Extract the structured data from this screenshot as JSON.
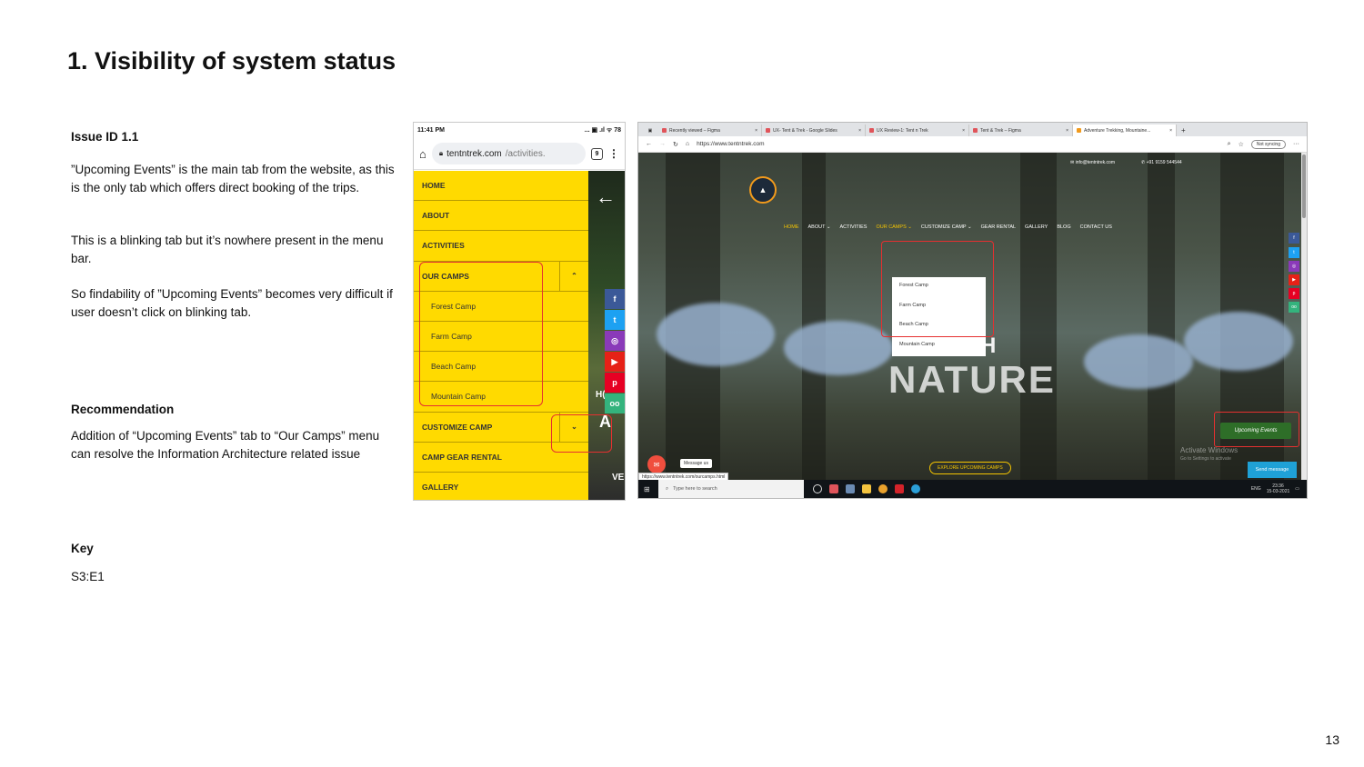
{
  "slide": {
    "title": "1. Visibility of system status",
    "page_number": "13",
    "issue_id": "Issue ID 1.1",
    "para1": "”Upcoming Events” is the main tab from the website, as this is the only tab which offers direct booking of the trips.",
    "para2": "This is a blinking tab but it’s nowhere present in the menu bar.",
    "para3": "So findability of ”Upcoming Events” becomes very difficult if user doesn’t click on blinking tab.",
    "recommendation_heading": "Recommendation",
    "recommendation": "Addition of “Upcoming Events” tab to “Our Camps” menu can resolve the Information Architecture related issue",
    "key_heading": "Key",
    "key_value": "S3:E1"
  },
  "phone": {
    "time": "11:41 PM",
    "status_icons": "... ▣ .ıl ᯤ 78",
    "url_domain": "tentntrek.com",
    "url_path": "/activities.",
    "tab_count": "9",
    "menu": [
      {
        "label": "HOME"
      },
      {
        "label": "ABOUT"
      },
      {
        "label": "ACTIVITIES"
      },
      {
        "label": "OUR CAMPS",
        "chevron": "⌃"
      },
      {
        "label": "Forest Camp",
        "sub": true
      },
      {
        "label": "Farm Camp",
        "sub": true
      },
      {
        "label": "Beach Camp",
        "sub": true
      },
      {
        "label": "Mountain Camp",
        "sub": true
      },
      {
        "label": "CUSTOMIZE CAMP",
        "chevron": "⌄"
      },
      {
        "label": "CAMP GEAR RENTAL"
      },
      {
        "label": "GALLERY"
      }
    ],
    "photo_text_1": "H(",
    "photo_text_2": "A",
    "photo_text_3": "VE",
    "social_icons": [
      {
        "name": "facebook-icon",
        "glyph": "f",
        "color": "#3b5998"
      },
      {
        "name": "twitter-icon",
        "glyph": "t",
        "color": "#1da1f2"
      },
      {
        "name": "instagram-icon",
        "glyph": "◎",
        "color": "#8a3ab9"
      },
      {
        "name": "youtube-icon",
        "glyph": "▶",
        "color": "#e62117"
      },
      {
        "name": "pinterest-icon",
        "glyph": "p",
        "color": "#e60023"
      },
      {
        "name": "tripadvisor-icon",
        "glyph": "oo",
        "color": "#34b37d"
      }
    ]
  },
  "desktop": {
    "tabs": [
      {
        "label": "Recently viewed – Figma"
      },
      {
        "label": "UX- Tent & Trek - Google Slides"
      },
      {
        "label": "UX Review-1: Tent n Trek"
      },
      {
        "label": "Tent & Trek – Figma"
      },
      {
        "label": "Adventure Trekking, Mountaine...",
        "active": true
      }
    ],
    "new_tab": "+",
    "url": "https://www.tentntrek.com",
    "not_syncing": "Not syncing",
    "email": "✉ info@tentntrek.com",
    "phone": "✆ +91 9159 544544",
    "nav": [
      {
        "label": "HOME",
        "active": true
      },
      {
        "label": "ABOUT ⌄"
      },
      {
        "label": "ACTIVITIES"
      },
      {
        "label": "OUR CAMPS ⌄",
        "active": true
      },
      {
        "label": "CUSTOMIZE CAMP ⌄"
      },
      {
        "label": "GEAR RENTAL"
      },
      {
        "label": "GALLERY"
      },
      {
        "label": "BLOG"
      },
      {
        "label": "CONTACT US"
      }
    ],
    "dropdown": [
      "Forest Camp",
      "Farm Camp",
      "Beach Camp",
      "Mountain Camp"
    ],
    "hero_line1": "WITH",
    "hero_line2": "NATURE",
    "upcoming_events": "Upcoming Events",
    "explore_button": "EXPLORE UPCOMING CAMPS",
    "activate_windows": "Activate Windows",
    "activate_sub": "Go to Settings to activate",
    "send_message": "Send message",
    "message_us": "Message us",
    "status_url": "https://www.tentntrek.com/ourcamps.html",
    "taskbar_search": "Type here to search",
    "tray_lang": "ENG",
    "tray_time": "23:36",
    "tray_date": "15-03-2021"
  }
}
